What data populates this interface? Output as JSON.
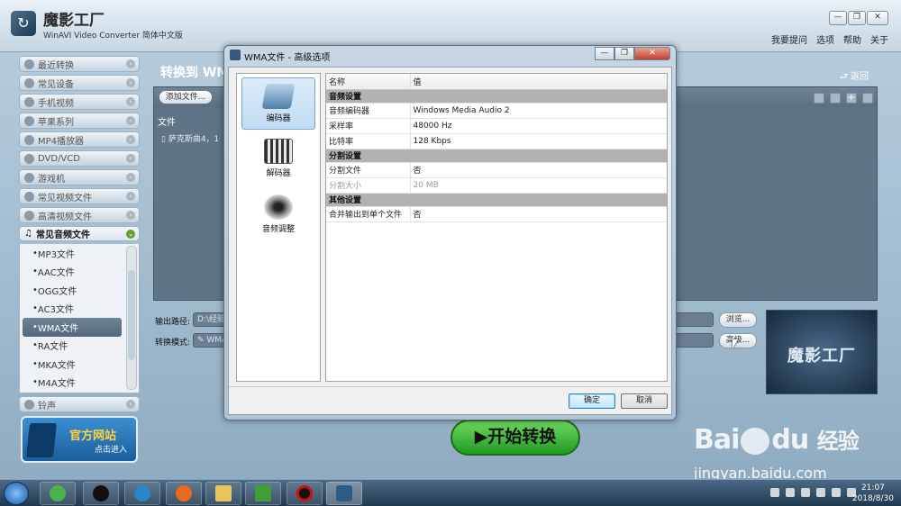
{
  "app": {
    "title": "魔影工厂",
    "subtitle": "WinAVI Video Converter 简体中文版",
    "top_links": [
      "我要提问",
      "选项",
      "帮助",
      "关于"
    ],
    "window_controls": [
      "—",
      "❐",
      "✕"
    ]
  },
  "sidebar": {
    "categories_top": [
      "最近转换",
      "常见设备",
      "手机视频",
      "苹果系列",
      "MP4播放器",
      "DVD/VCD",
      "游戏机",
      "常见视频文件",
      "高清视频文件"
    ],
    "open_category": "常见音频文件",
    "sub_items": [
      "MP3文件",
      "AAC文件",
      "OGG文件",
      "AC3文件",
      "WMA文件",
      "RA文件",
      "MKA文件",
      "M4A文件"
    ],
    "selected_sub": "WMA文件",
    "categories_bottom": [
      "铃声"
    ],
    "banner_title": "官方网站",
    "banner_sub": "点击进入"
  },
  "main": {
    "title": "转换到 WMA",
    "back_label": "返回",
    "add_file_label": "添加文件...",
    "file_column_header": "文件",
    "file_row": "萨克斯曲4，1",
    "output_path_label": "输出路径:",
    "output_path_value": "D:\\经验",
    "mode_label": "转换模式:",
    "mode_value": "WMA",
    "browse_label": "浏览...",
    "advanced_label": "高级...",
    "logo_text": "魔影工厂",
    "start_label": "▶开始转换"
  },
  "dialog": {
    "title": "WMA文件 - 高级选项",
    "nav": [
      "编码器",
      "解码器",
      "音频调整"
    ],
    "selected_nav": "编码器",
    "table_header": {
      "key": "名称",
      "value": "值"
    },
    "rows": [
      {
        "type": "section",
        "key": "音频设置",
        "value": ""
      },
      {
        "type": "row",
        "key": "音频编码器",
        "value": "Windows Media Audio 2"
      },
      {
        "type": "row",
        "key": "采样率",
        "value": "48000 Hz"
      },
      {
        "type": "row",
        "key": "比特率",
        "value": "128 Kbps"
      },
      {
        "type": "section",
        "key": "分割设置",
        "value": ""
      },
      {
        "type": "row",
        "key": "分割文件",
        "value": "否"
      },
      {
        "type": "disabled",
        "key": "分割大小",
        "value": "20 MB"
      },
      {
        "type": "section",
        "key": "其他设置",
        "value": ""
      },
      {
        "type": "row",
        "key": "合并输出到单个文件",
        "value": "否"
      }
    ],
    "ok_label": "确定",
    "cancel_label": "取消"
  },
  "watermark": {
    "logo": "Bai",
    "logo_tail": "du",
    "logo_cn": "经验",
    "url": "jingyan.baidu.com"
  },
  "taskbar": {
    "time": "21:07",
    "date": "2018/8/30"
  }
}
